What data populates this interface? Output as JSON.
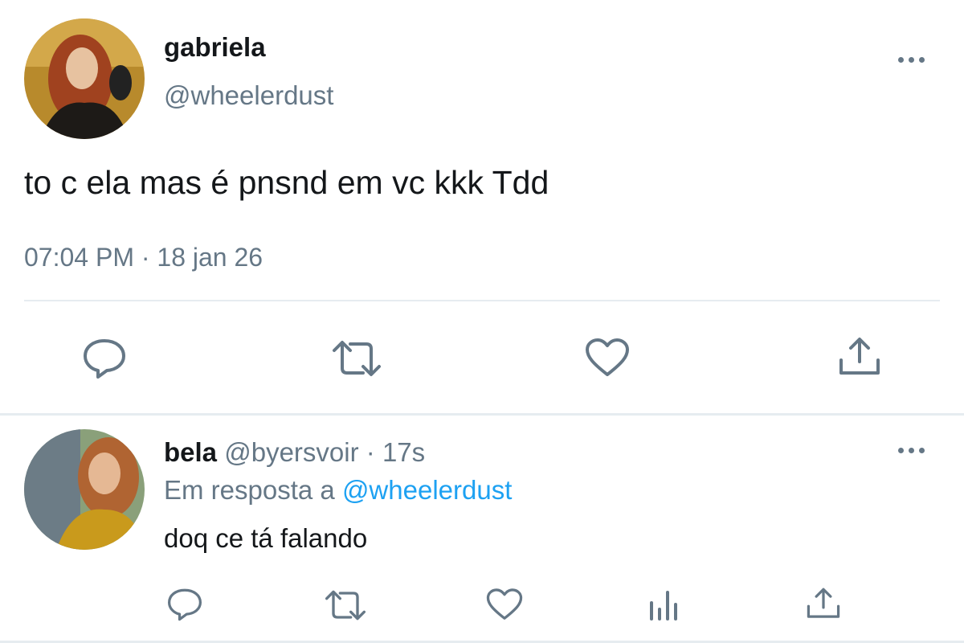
{
  "tweet": {
    "author_name": "gabriela",
    "author_handle": "@wheelerdust",
    "text": "to c ela mas é pnsnd em vc kkk Tdd",
    "time": "07:04 PM",
    "separator": "·",
    "date": "18 jan 26",
    "actions": [
      "reply-icon",
      "retweet-icon",
      "like-icon",
      "share-icon"
    ]
  },
  "reply": {
    "author_name": "bela",
    "author_handle": "@byersvoir",
    "separator": "·",
    "age": "17s",
    "in_reply_prefix": "Em resposta a",
    "in_reply_handle": "@wheelerdust",
    "text": "doq ce tá falando",
    "actions": [
      "reply-icon",
      "retweet-icon",
      "like-icon",
      "analytics-icon",
      "share-icon"
    ]
  },
  "colors": {
    "text_primary": "#14171a",
    "text_muted": "#657786",
    "link": "#1da1f2",
    "divider": "#e6ecf0"
  }
}
